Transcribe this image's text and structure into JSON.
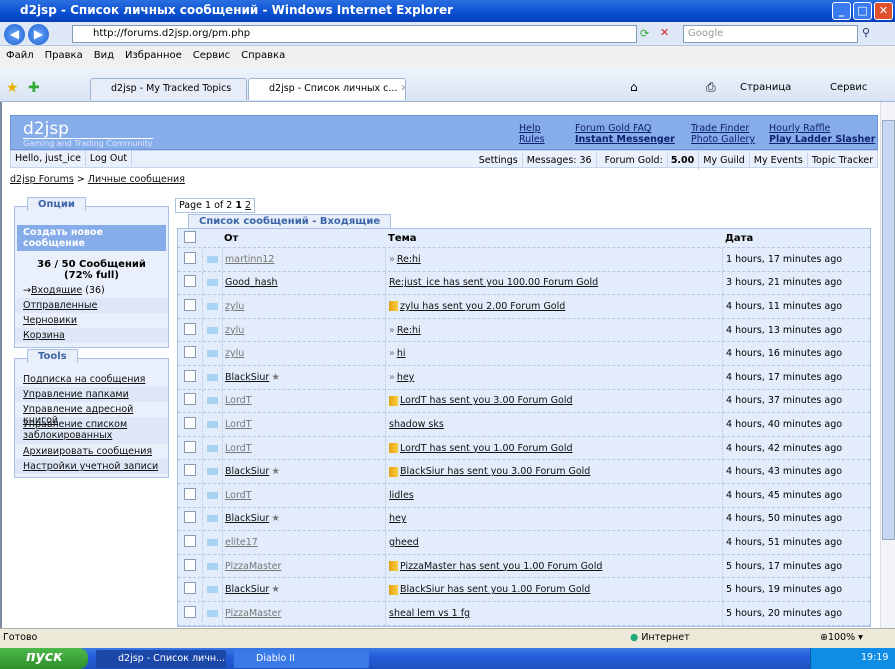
{
  "window": {
    "title": "d2jsp - Список личных сообщений - Windows Internet Explorer",
    "url": "http://forums.d2jsp.org/pm.php",
    "search_placeholder": "Google"
  },
  "menu": [
    "Файл",
    "Правка",
    "Вид",
    "Избранное",
    "Сервис",
    "Справка"
  ],
  "tabs": [
    {
      "label": "d2jsp - My Tracked Topics"
    },
    {
      "label": "d2jsp - Список личных с...",
      "active": true
    }
  ],
  "toolbar": {
    "page": "Страница",
    "tools": "Сервис"
  },
  "site": {
    "logo": "d2jsp",
    "tagline": "Gaming and Trading Community",
    "links": {
      "help": "Help",
      "rules": "Rules",
      "gold_faq": "Forum Gold FAQ",
      "im": "Instant Messenger",
      "trade": "Trade Finder",
      "photo": "Photo Gallery",
      "raffle": "Hourly Raffle",
      "slasher": "Play Ladder Slasher"
    },
    "user": {
      "hello": "Hello, just_ice",
      "logout": "Log Out"
    },
    "right": {
      "settings": "Settings",
      "messages": "Messages: 36",
      "gold_label": "Forum Gold:",
      "gold_value": "5.00",
      "guild": "My Guild",
      "events": "My Events",
      "tracker": "Topic Tracker"
    }
  },
  "breadcrumb": {
    "home": "d2jsp Forums",
    "sep": ">",
    "current": "Личные сообщения"
  },
  "options": {
    "title": "Опции",
    "create": "Создать новое сообщение",
    "usage": "36 / 50 Сообщений",
    "full": "(72% full)",
    "arrow": "→",
    "inbox": "Входящие",
    "inbox_count": "(36)",
    "sent": "Отправленные",
    "drafts": "Черновики",
    "trash": "Корзина"
  },
  "tools": {
    "title": "Tools",
    "items": [
      "Подписка на сообщения",
      "Управление папками",
      "Управление адресной книгой",
      "Управление списком заблокированных",
      "Архивировать сообщения",
      "Настройки учетной записи"
    ]
  },
  "pager": {
    "label": "Page 1 of 2",
    "current": "1",
    "next": "2"
  },
  "list": {
    "title": "Список сообщений - Входящие",
    "columns": [
      "От",
      "Тема",
      "Дата"
    ],
    "rows": [
      {
        "from": "martinn12",
        "read": true,
        "star": false,
        "prefix": "reply",
        "subject": "Re:hi",
        "date": "1 hours, 17 minutes ago"
      },
      {
        "from": "Good_hash",
        "read": false,
        "star": false,
        "prefix": "",
        "subject": "Re:just_ice has sent you 100.00 Forum Gold",
        "date": "3 hours, 21 minutes ago"
      },
      {
        "from": "zylu",
        "read": true,
        "star": false,
        "prefix": "gold",
        "subject": "zylu has sent you 2.00 Forum Gold",
        "date": "4 hours, 11 minutes ago"
      },
      {
        "from": "zylu",
        "read": true,
        "star": false,
        "prefix": "reply",
        "subject": "Re:hi",
        "date": "4 hours, 13 minutes ago"
      },
      {
        "from": "zylu",
        "read": true,
        "star": false,
        "prefix": "reply",
        "subject": "hi",
        "date": "4 hours, 16 minutes ago"
      },
      {
        "from": "BlackSiur",
        "read": false,
        "star": true,
        "prefix": "reply",
        "subject": "hey",
        "date": "4 hours, 17 minutes ago"
      },
      {
        "from": "LordT",
        "read": true,
        "star": false,
        "prefix": "gold",
        "subject": "LordT has sent you 3.00 Forum Gold",
        "date": "4 hours, 37 minutes ago"
      },
      {
        "from": "LordT",
        "read": true,
        "star": false,
        "prefix": "",
        "subject": "shadow sks",
        "date": "4 hours, 40 minutes ago"
      },
      {
        "from": "LordT",
        "read": true,
        "star": false,
        "prefix": "gold",
        "subject": "LordT has sent you 1.00 Forum Gold",
        "date": "4 hours, 42 minutes ago"
      },
      {
        "from": "BlackSiur",
        "read": false,
        "star": true,
        "prefix": "gold",
        "subject": "BlackSiur has sent you 3.00 Forum Gold",
        "date": "4 hours, 43 minutes ago"
      },
      {
        "from": "LordT",
        "read": true,
        "star": false,
        "prefix": "",
        "subject": "lidles",
        "date": "4 hours, 45 minutes ago"
      },
      {
        "from": "BlackSiur",
        "read": false,
        "star": true,
        "prefix": "",
        "subject": "hey",
        "date": "4 hours, 50 minutes ago"
      },
      {
        "from": "elite17",
        "read": true,
        "star": false,
        "prefix": "",
        "subject": "gheed",
        "date": "4 hours, 51 minutes ago"
      },
      {
        "from": "PizzaMaster",
        "read": true,
        "star": false,
        "prefix": "gold",
        "subject": "PizzaMaster has sent you 1.00 Forum Gold",
        "date": "5 hours, 17 minutes ago"
      },
      {
        "from": "BlackSiur",
        "read": false,
        "star": true,
        "prefix": "gold",
        "subject": "BlackSiur has sent you 1.00 Forum Gold",
        "date": "5 hours, 19 minutes ago"
      },
      {
        "from": "PizzaMaster",
        "read": true,
        "star": false,
        "prefix": "",
        "subject": "sheal lem vs 1 fg",
        "date": "5 hours, 20 minutes ago"
      }
    ]
  },
  "statusbar": {
    "text": "Готово",
    "zone": "Интернет",
    "zoom": "100%"
  },
  "taskbar": {
    "start": "пуск",
    "items": [
      "d2jsp - Список личн...",
      "Diablo II"
    ],
    "clock": "19:19"
  }
}
